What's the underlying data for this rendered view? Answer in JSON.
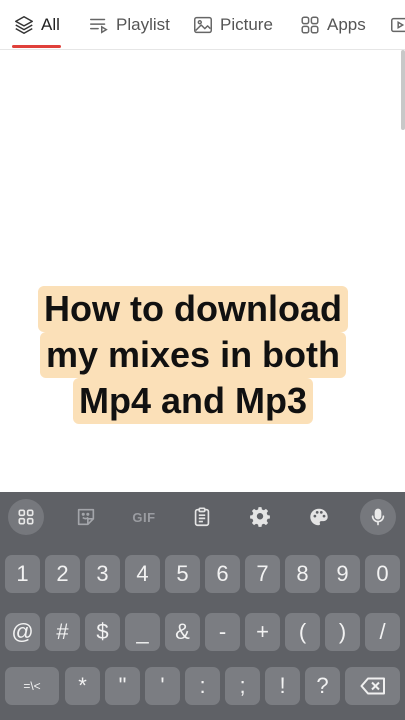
{
  "tabs": [
    {
      "label": "All",
      "icon": "layers-icon",
      "active": true
    },
    {
      "label": "Playlist",
      "icon": "playlist-icon",
      "active": false
    },
    {
      "label": "Picture",
      "icon": "image-icon",
      "active": false
    },
    {
      "label": "Apps",
      "icon": "apps-grid-icon",
      "active": false
    }
  ],
  "caption": {
    "line1": "How to download",
    "line2": "my mixes in both",
    "line3": "Mp4 and Mp3"
  },
  "keyboard": {
    "toolbar": {
      "gif_label": "GIF"
    },
    "row1": [
      "1",
      "2",
      "3",
      "4",
      "5",
      "6",
      "7",
      "8",
      "9",
      "0"
    ],
    "row2": [
      "@",
      "#",
      "$",
      "_",
      "&",
      "-",
      "+",
      "(",
      ")",
      "/"
    ],
    "row3": [
      "=\\<",
      "*",
      "\"",
      "'",
      ":",
      ";",
      "!",
      "?"
    ]
  },
  "colors": {
    "accent": "#e0403a",
    "caption_bg": "#fbe0b8",
    "keyboard_bg": "#5f6166",
    "key_bg": "#7b7d82"
  }
}
